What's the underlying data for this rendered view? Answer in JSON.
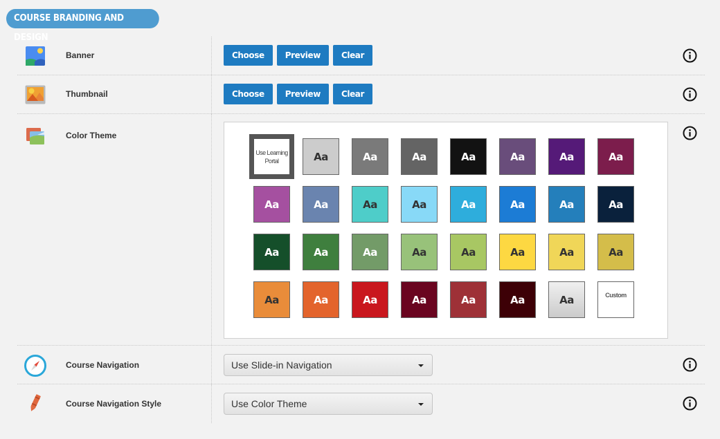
{
  "section": {
    "title": "COURSE BRANDING AND DESIGN"
  },
  "rows": {
    "banner": {
      "label": "Banner",
      "buttons": {
        "choose": "Choose",
        "preview": "Preview",
        "clear": "Clear"
      }
    },
    "thumbnail": {
      "label": "Thumbnail",
      "buttons": {
        "choose": "Choose",
        "preview": "Preview",
        "clear": "Clear"
      }
    },
    "color_theme": {
      "label": "Color Theme",
      "selected_index": 0,
      "swatches": [
        {
          "type": "portal",
          "label": "Use Learning Portal",
          "bg": "#ffffff",
          "fg": "#444444"
        },
        {
          "type": "color",
          "label": "Aa",
          "bg": "#cccccc",
          "fg": "#333333"
        },
        {
          "type": "color",
          "label": "Aa",
          "bg": "#7a7a7a",
          "fg": "#ffffff"
        },
        {
          "type": "color",
          "label": "Aa",
          "bg": "#646464",
          "fg": "#ffffff"
        },
        {
          "type": "color",
          "label": "Aa",
          "bg": "#121212",
          "fg": "#ffffff"
        },
        {
          "type": "color",
          "label": "Aa",
          "bg": "#694d7b",
          "fg": "#ffffff"
        },
        {
          "type": "color",
          "label": "Aa",
          "bg": "#551a78",
          "fg": "#ffffff"
        },
        {
          "type": "color",
          "label": "Aa",
          "bg": "#7c1d4c",
          "fg": "#ffffff"
        },
        {
          "type": "color",
          "label": "Aa",
          "bg": "#a550a0",
          "fg": "#ffffff"
        },
        {
          "type": "color",
          "label": "Aa",
          "bg": "#6a84af",
          "fg": "#ffffff"
        },
        {
          "type": "color",
          "label": "Aa",
          "bg": "#4ecdc9",
          "fg": "#333333"
        },
        {
          "type": "color",
          "label": "Aa",
          "bg": "#88d9f7",
          "fg": "#333333"
        },
        {
          "type": "color",
          "label": "Aa",
          "bg": "#2eaddc",
          "fg": "#ffffff"
        },
        {
          "type": "color",
          "label": "Aa",
          "bg": "#1c7cd5",
          "fg": "#ffffff"
        },
        {
          "type": "color",
          "label": "Aa",
          "bg": "#247fbb",
          "fg": "#ffffff"
        },
        {
          "type": "color",
          "label": "Aa",
          "bg": "#0a213c",
          "fg": "#ffffff"
        },
        {
          "type": "color",
          "label": "Aa",
          "bg": "#154f2a",
          "fg": "#ffffff"
        },
        {
          "type": "color",
          "label": "Aa",
          "bg": "#3f7f3e",
          "fg": "#ffffff"
        },
        {
          "type": "color",
          "label": "Aa",
          "bg": "#739b68",
          "fg": "#ffffff"
        },
        {
          "type": "color",
          "label": "Aa",
          "bg": "#98c27a",
          "fg": "#333333"
        },
        {
          "type": "color",
          "label": "Aa",
          "bg": "#a8c763",
          "fg": "#333333"
        },
        {
          "type": "color",
          "label": "Aa",
          "bg": "#fdd842",
          "fg": "#333333"
        },
        {
          "type": "color",
          "label": "Aa",
          "bg": "#f0d658",
          "fg": "#333333"
        },
        {
          "type": "color",
          "label": "Aa",
          "bg": "#d4bd4a",
          "fg": "#333333"
        },
        {
          "type": "color",
          "label": "Aa",
          "bg": "#e98c3a",
          "fg": "#333333"
        },
        {
          "type": "color",
          "label": "Aa",
          "bg": "#e3642c",
          "fg": "#ffffff"
        },
        {
          "type": "color",
          "label": "Aa",
          "bg": "#c9171e",
          "fg": "#ffffff"
        },
        {
          "type": "color",
          "label": "Aa",
          "bg": "#6a0520",
          "fg": "#ffffff"
        },
        {
          "type": "color",
          "label": "Aa",
          "bg": "#9e3137",
          "fg": "#ffffff"
        },
        {
          "type": "color",
          "label": "Aa",
          "bg": "#3d0006",
          "fg": "#ffffff"
        },
        {
          "type": "gradient",
          "label": "Aa",
          "bg": "linear-gradient(#f0f0f0, #cbcbcb)",
          "fg": "#333333"
        },
        {
          "type": "custom",
          "label": "Custom",
          "bg": "#ffffff",
          "fg": "#555555"
        }
      ]
    },
    "course_navigation": {
      "label": "Course Navigation",
      "selected": "Use Slide-in Navigation"
    },
    "course_navigation_style": {
      "label": "Course Navigation Style",
      "selected": "Use Color Theme"
    }
  },
  "icons": {
    "banner": "landscape-image-icon",
    "thumbnail": "thumbnail-image-icon",
    "color_theme": "color-theme-icon",
    "course_navigation": "compass-icon",
    "course_navigation_style": "crayon-icon",
    "info": "info-icon"
  }
}
